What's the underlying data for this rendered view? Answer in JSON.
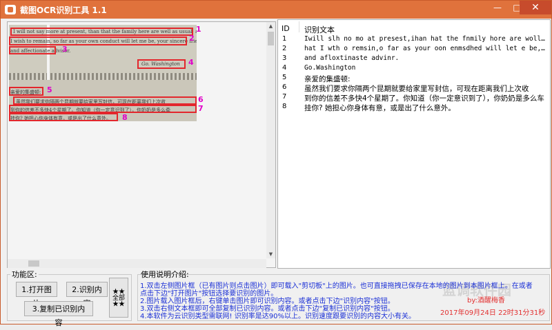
{
  "window": {
    "title": "截图OCR识别工具 1.1",
    "min_glyph": "—",
    "max_glyph": "□",
    "close_glyph": "✕"
  },
  "scan": {
    "lines": [
      "I will not say more at present, than that the family here are well as usual; and",
      "I wish to remain, so far as your own conduct will let me be, your sincere friend",
      "and affectionate advisor.",
      "Go. Washington",
      "亲爱的集盛顿:",
      "虽然我们要求你隔两个昆期就要给家里写封信，可现在距离我们上次收",
      "到你的信差不多快4个星期了。你知道（你一定意识到了），你奶奶是多么牵",
      "挂你? 她担心你身体有意，或是出了什么意外。"
    ],
    "numbers": [
      "1",
      "2",
      "3",
      "4",
      "5",
      "6",
      "7",
      "8"
    ]
  },
  "table": {
    "col_id": "ID",
    "col_text": "识别文本",
    "rows": [
      {
        "id": "1",
        "text": "Iwill slh no mo at presest,ihan hat the fnmily hore are wollac us..."
      },
      {
        "id": "2",
        "text": "hat I wth o remsin,o far as your oon enmsdhed will let e be,roar ..."
      },
      {
        "id": "3",
        "text": "and afloxtinaste advinr."
      },
      {
        "id": "4",
        "text": "Go.Washington"
      },
      {
        "id": "5",
        "text": "亲爱的集盛顿:"
      },
      {
        "id": "6",
        "text": "虽然我们要求你隔两个昆期就要给家里写封信，可现在距离我们上次收"
      },
      {
        "id": "7",
        "text": "到你的信差不多快4个星期了。你知道（你一定意识到了），你奶奶是多么车"
      },
      {
        "id": "8",
        "text": "挂你? 她担心你身体有意，或是出了什么意外。"
      }
    ]
  },
  "functions": {
    "label": "功能区:",
    "open_label": "1.打开图片",
    "recognize_label": "2.识别内容",
    "copy_label": "3.复制已识别内容",
    "all_label": "★★全部★★"
  },
  "help": {
    "label": "使用说明介绍:",
    "lines": [
      "1.双击左侧图片框（已有图片则点击图片）即可载入\"剪切板\"上的图片。也可直接拖拽已保存在本地的图片到本图片框上。在或者",
      "点击下边\"打开图片\"按钮选择要识别的图片。",
      "2.图片载入图片框后，右键单击图片即可识别内容。或者点击下边\"识别内容\"按钮。",
      "3.双击右侧文本框即可全部复制已识别内容。或者点击下边\"复制已识别内容\"按钮。",
      "4.本软件为云识别类型需联网! 识别率是达90%以上。识别速度跟要识别的内容大小有关。"
    ],
    "sign": "by:酒醒梅香",
    "datetime": "2017年09月24日 22时31分31秒",
    "watermark": "蓝调软件园"
  }
}
